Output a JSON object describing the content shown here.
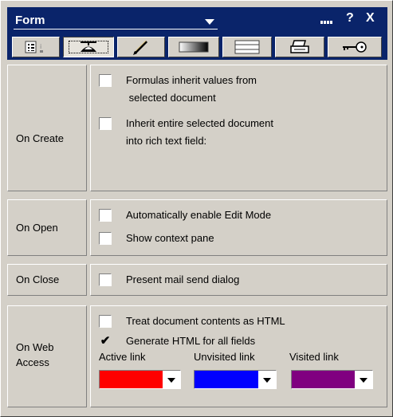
{
  "window": {
    "title": "Form",
    "help_label": "?",
    "close_label": "X"
  },
  "tabs": [
    {
      "icon": "info-icon",
      "active": false
    },
    {
      "icon": "propeller-hat-icon",
      "active": true
    },
    {
      "icon": "pen-icon",
      "active": false
    },
    {
      "icon": "background-icon",
      "active": false
    },
    {
      "icon": "header-footer-icon",
      "active": false
    },
    {
      "icon": "printer-icon",
      "active": false
    },
    {
      "icon": "key-icon",
      "active": false
    }
  ],
  "sections": {
    "on_create": {
      "label": "On Create",
      "options": [
        {
          "line1": "Formulas inherit values from",
          "line2": " selected document",
          "checked": false
        },
        {
          "line1": "Inherit entire selected document",
          "line2": "into rich text field:",
          "checked": false
        }
      ]
    },
    "on_open": {
      "label": "On Open",
      "options": [
        {
          "text": "Automatically enable Edit Mode",
          "checked": false
        },
        {
          "text": "Show context pane",
          "checked": false
        }
      ]
    },
    "on_close": {
      "label": "On Close",
      "options": [
        {
          "text": "Present mail send dialog",
          "checked": false
        }
      ]
    },
    "on_web_access": {
      "label_line1": "On Web",
      "label_line2": "Access",
      "options": [
        {
          "text": "Treat document contents as HTML",
          "checked": false
        },
        {
          "text": "Generate HTML for all fields",
          "checked": true,
          "mark": "✔"
        }
      ],
      "colors": {
        "active_link": {
          "label": "Active link",
          "color": "#ff0000"
        },
        "unvisited_link": {
          "label": "Unvisited link",
          "color": "#0000ff"
        },
        "visited_link": {
          "label": "Visited link",
          "color": "#800080"
        }
      }
    }
  }
}
